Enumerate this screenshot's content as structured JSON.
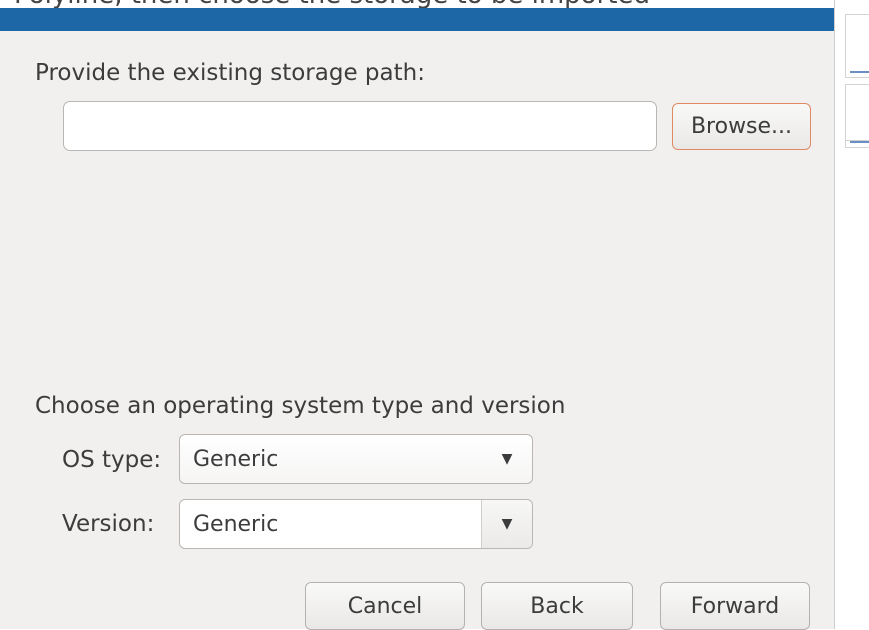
{
  "window": {
    "partial_top_text": "Polyline, then choose the storage to be imported"
  },
  "storage": {
    "prompt": "Provide the existing storage path:",
    "path_value": "",
    "browse_label": "Browse..."
  },
  "os": {
    "heading": "Choose an operating system type and version",
    "type_label": "OS type:",
    "type_value": "Generic",
    "version_label": "Version:",
    "version_value": "Generic"
  },
  "buttons": {
    "cancel": "Cancel",
    "back": "Back",
    "forward": "Forward"
  },
  "icons": {
    "dropdown": "chevron-down-icon"
  },
  "colors": {
    "title_bar": "#1e67a6",
    "dialog_bg": "#f1f0ef",
    "focus_border": "#e08a65"
  }
}
